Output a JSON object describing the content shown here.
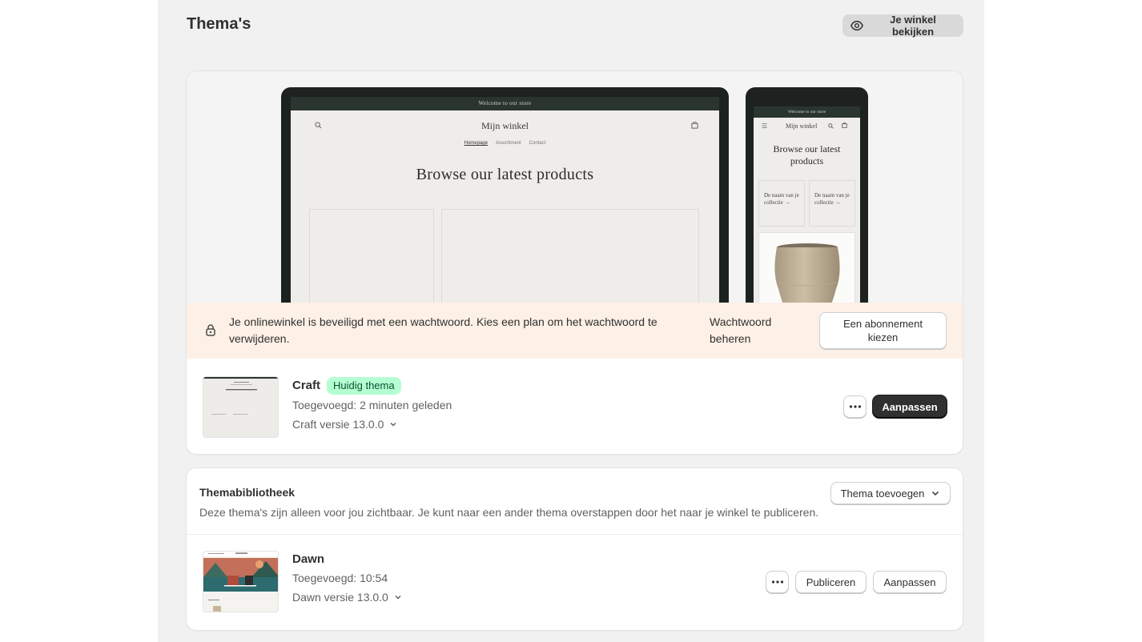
{
  "page": {
    "title": "Thema's",
    "view_store_label": "Je winkel bekijken"
  },
  "preview": {
    "desktop": {
      "announcement": "Welcome to our store",
      "store_name": "Mijn winkel",
      "nav": [
        "Homepage",
        "Assortiment",
        "Contact"
      ],
      "hero": "Browse our latest products"
    },
    "mobile": {
      "announcement": "Welcome to our store",
      "store_name": "Mijn winkel",
      "hero": "Browse our latest products",
      "collection_1": "De naam van je collectie →",
      "collection_2": "De naam van je collectie →"
    }
  },
  "password_banner": {
    "text": "Je onlinewinkel is beveiligd met een wachtwoord. Kies een plan om het wachtwoord te verwijderen.",
    "manage_label": "Wachtwoord beheren",
    "plan_button": "Een abonnement kiezen"
  },
  "current_theme": {
    "name": "Craft",
    "badge": "Huidig thema",
    "added": "Toegevoegd: 2 minuten geleden",
    "version": "Craft versie 13.0.0",
    "customize_label": "Aanpassen"
  },
  "library": {
    "title": "Themabibliotheek",
    "description": "Deze thema's zijn alleen voor jou zichtbaar. Je kunt naar een ander thema overstappen door het naar je winkel te publiceren.",
    "add_theme_label": "Thema toevoegen",
    "themes": [
      {
        "name": "Dawn",
        "added": "Toegevoegd: 10:54",
        "version": "Dawn versie 13.0.0",
        "publish_label": "Publiceren",
        "customize_label": "Aanpassen"
      }
    ]
  },
  "colors": {
    "page_bg": "#f1f1f1",
    "banner_bg": "#fdf0e6",
    "badge_bg": "#b4fed2",
    "badge_text": "#0c5132",
    "primary_button": "#303030"
  }
}
